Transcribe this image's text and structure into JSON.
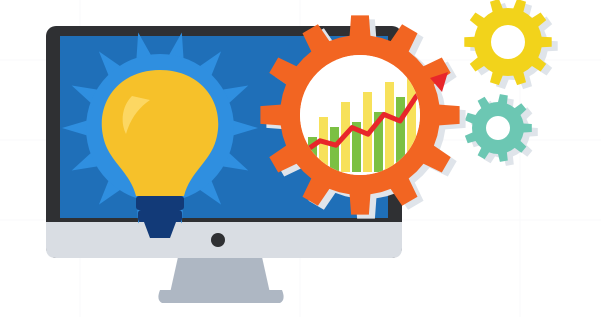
{
  "illustration": {
    "subject": "idea-to-growth",
    "elements": [
      "monitor",
      "lightbulb",
      "orange-gear",
      "yellow-gear",
      "teal-gear",
      "growth-chart",
      "trend-arrow"
    ]
  },
  "colors": {
    "background": "#ffffff",
    "bezel": "#2f3033",
    "screen": "#1f6fb8",
    "screen_rays": "#2f8fe0",
    "monitor_chin": "#d9dde3",
    "stand": "#aeb7c3",
    "bulb": "#f6c12a",
    "bulb_highlight": "#ffe07a",
    "bulb_base": "#123a78",
    "gear_orange": "#f26522",
    "gear_yellow": "#f2d31b",
    "gear_teal": "#6cc7b3",
    "gear_shadow": "#dfe4ea",
    "bars_green": "#7bc043",
    "bars_yellow": "#f7e15a",
    "trend_red": "#e8262a"
  },
  "chart": {
    "bar_values": [
      35,
      55,
      45,
      70,
      50,
      80,
      60,
      90,
      75,
      100
    ],
    "trend_points": [
      12,
      22,
      18,
      34,
      28,
      46,
      40,
      62,
      78
    ]
  }
}
